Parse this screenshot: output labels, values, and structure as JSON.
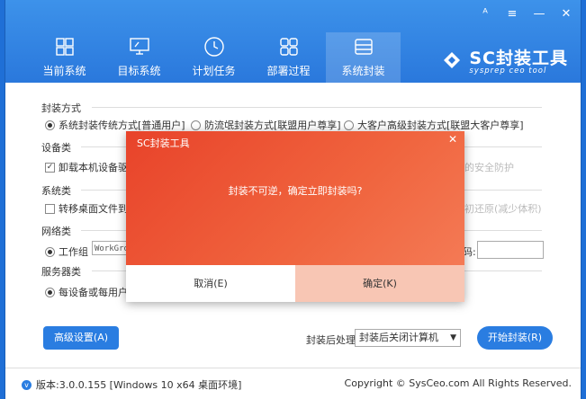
{
  "window_controls": {
    "user": "ᴬ",
    "menu": "≡",
    "minimize": "—",
    "close": "✕"
  },
  "nav": [
    {
      "label": "当前系统",
      "icon": "windows-icon"
    },
    {
      "label": "目标系统",
      "icon": "monitor-icon"
    },
    {
      "label": "计划任务",
      "icon": "clock-icon"
    },
    {
      "label": "部署过程",
      "icon": "grid-icon"
    },
    {
      "label": "系统封装",
      "icon": "drive-icon",
      "active": true
    }
  ],
  "logo": {
    "title": "SC封装工具",
    "subtitle": "sysprep ceo tool"
  },
  "sections": {
    "pack_mode": {
      "title": "封装方式",
      "options": [
        "系统封装传统方式[普通用户]",
        "防流氓封装方式[联盟用户尊享]",
        "大客户高级封装方式[联盟大客户尊享]"
      ]
    },
    "device": {
      "title": "设备类",
      "option": "卸载本机设备驱动",
      "right_faint": "的安全防护"
    },
    "system": {
      "title": "系统类",
      "option": "转移桌面文件到所",
      "right_faint": "初还原(减少体积)"
    },
    "network": {
      "title": "网络类",
      "option": "工作组",
      "workgroup_value": "WorkGroup",
      "right_label": "码:"
    },
    "server": {
      "title": "服务器类",
      "option": "每设备或每用户"
    }
  },
  "bottom": {
    "advanced_button": "高级设置(A)",
    "after_label": "封装后处理:",
    "after_value": "封装后关闭计算机",
    "start_button": "开始封装(R)"
  },
  "status": {
    "version": "版本:3.0.0.155 [Windows 10 x64 桌面环境]",
    "copyright": "Copyright © SysCeo.com All Rights Reserved."
  },
  "dialog": {
    "title": "SC封装工具",
    "message": "封装不可逆，确定立即封装吗?",
    "cancel": "取消(E)",
    "ok": "确定(K)"
  },
  "colors": {
    "header": "#2a78dc",
    "accent": "#2a7de1",
    "dialog": "#ec5535",
    "ok_bg": "#f8c6b4"
  }
}
